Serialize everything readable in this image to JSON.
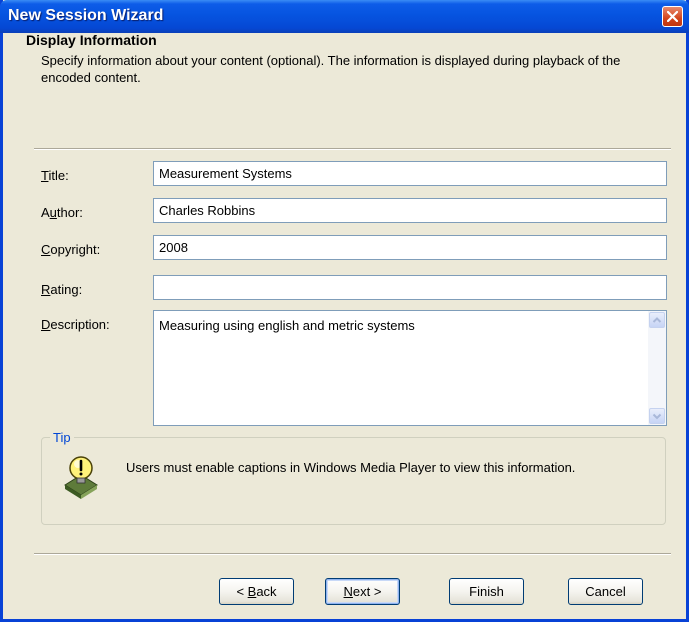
{
  "window": {
    "title": "New Session Wizard"
  },
  "header": {
    "title": "Display Information",
    "description": "Specify information about your content (optional). The information is displayed during playback of the encoded content."
  },
  "fields": {
    "title": {
      "label_first": "T",
      "label_rest": "itle:",
      "value": "Measurement Systems"
    },
    "author": {
      "label_first": "A",
      "label_underline": "u",
      "label_rest": "thor:",
      "value": "Charles Robbins"
    },
    "copyright": {
      "label_first": "C",
      "label_rest": "opyright:",
      "value": "2008"
    },
    "rating": {
      "label_first": "R",
      "label_rest": "ating:",
      "value": ""
    },
    "description": {
      "label_first": "D",
      "label_rest": "escription:",
      "value": "Measuring using english and metric systems"
    }
  },
  "tip": {
    "legend": "Tip",
    "text": "Users must enable captions in Windows Media Player to view this information.",
    "icon": "lightbulb-tip-icon"
  },
  "buttons": {
    "back": {
      "prefix": "< ",
      "underline": "B",
      "rest": "ack"
    },
    "next": {
      "underline": "N",
      "rest": "ext >"
    },
    "finish": "Finish",
    "cancel": "Cancel"
  },
  "colors": {
    "titlebar": "#0654e0",
    "close_button": "#d2441c",
    "dialog_bg": "#ece9d8",
    "tip_legend": "#0046d5"
  }
}
